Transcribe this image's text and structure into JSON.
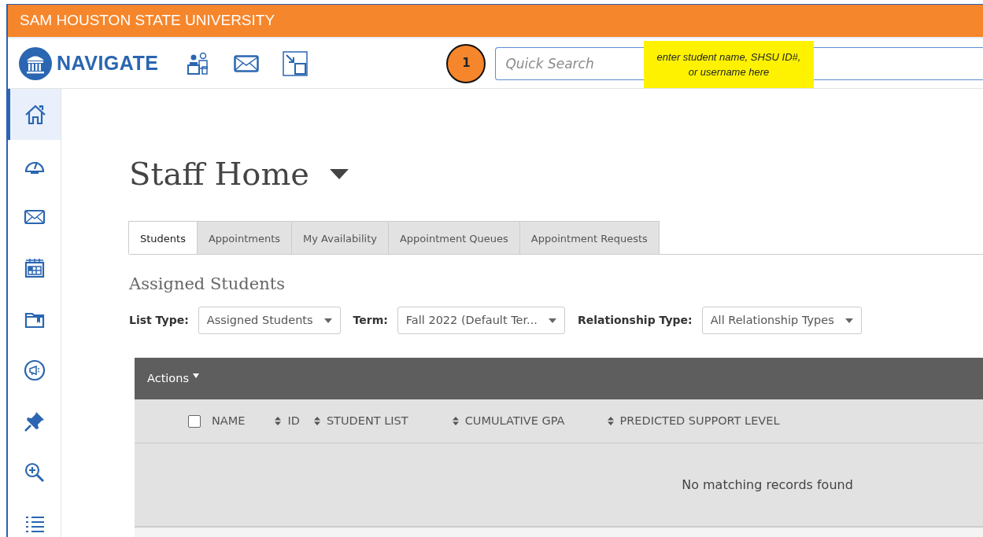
{
  "banner": {
    "title": "SAM HOUSTON STATE UNIVERSITY"
  },
  "brand": {
    "name": "NAVIGATE"
  },
  "callout": {
    "number": "1",
    "note": "enter student name, SHSU ID#,\nor username here"
  },
  "search": {
    "placeholder": "Quick Search"
  },
  "sidebar": {
    "items": [
      {
        "selected": true
      },
      {
        "selected": false
      },
      {
        "selected": false
      },
      {
        "selected": false
      },
      {
        "selected": false
      },
      {
        "selected": false
      },
      {
        "selected": false
      },
      {
        "selected": false
      },
      {
        "selected": false
      }
    ]
  },
  "page": {
    "title": "Staff Home"
  },
  "tabs": [
    {
      "label": "Students",
      "selected": true
    },
    {
      "label": "Appointments",
      "selected": false
    },
    {
      "label": "My Availability",
      "selected": false
    },
    {
      "label": "Appointment Queues",
      "selected": false
    },
    {
      "label": "Appointment Requests",
      "selected": false
    }
  ],
  "section": {
    "title": "Assigned Students"
  },
  "filters": [
    {
      "label": "List Type:",
      "value": "Assigned Students"
    },
    {
      "label": "Term:",
      "value": "Fall 2022 (Default Ter..."
    },
    {
      "label": "Relationship Type:",
      "value": "All Relationship Types"
    }
  ],
  "table": {
    "actions": "Actions",
    "select_all": {
      "checked": false
    },
    "columns": [
      {
        "label": "NAME",
        "sortable": false
      },
      {
        "label": "ID",
        "sortable": true
      },
      {
        "label": "STUDENT LIST",
        "sortable": true
      },
      {
        "label": "CUMULATIVE GPA",
        "sortable": true
      },
      {
        "label": "PREDICTED SUPPORT LEVEL",
        "sortable": true
      }
    ],
    "empty": "No matching records found"
  }
}
